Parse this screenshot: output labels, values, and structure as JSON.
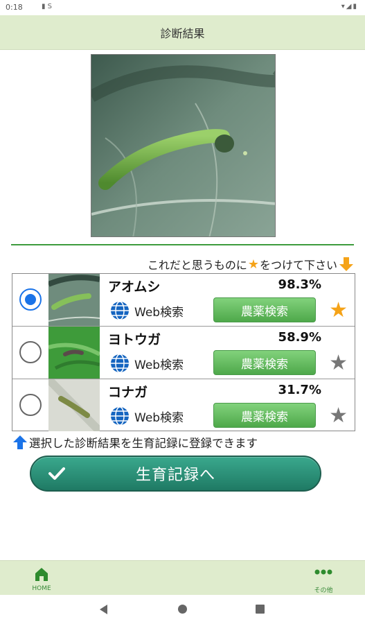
{
  "status_bar": {
    "time": "0:18",
    "left_icons": "▮ S",
    "right_icons": "▾◢▮"
  },
  "header": {
    "title": "診断結果"
  },
  "instruction": {
    "before_star": "これだと思うものに",
    "star": "★",
    "after_star": "をつけて下さい"
  },
  "results": [
    {
      "name": "アオムシ",
      "confidence": "98.3%",
      "web_label": "Web検索",
      "agri_label": "農薬検索",
      "selected": true,
      "starred": true
    },
    {
      "name": "ヨトウガ",
      "confidence": "58.9%",
      "web_label": "Web検索",
      "agri_label": "農薬検索",
      "selected": false,
      "starred": false
    },
    {
      "name": "コナガ",
      "confidence": "31.7%",
      "web_label": "Web検索",
      "agri_label": "農薬検索",
      "selected": false,
      "starred": false
    }
  ],
  "note": "選択した診断結果を生育記録に登録できます",
  "record_button": {
    "label": "生育記録へ"
  },
  "bottom_nav": {
    "home_label": "HOME",
    "other_label": "その他"
  },
  "colors": {
    "header_bg": "#dfeccd",
    "accent_green": "#3d9b3d",
    "star_orange": "#f5a318",
    "radio_blue": "#1a73e8",
    "button_teal": "#1f7a64"
  }
}
